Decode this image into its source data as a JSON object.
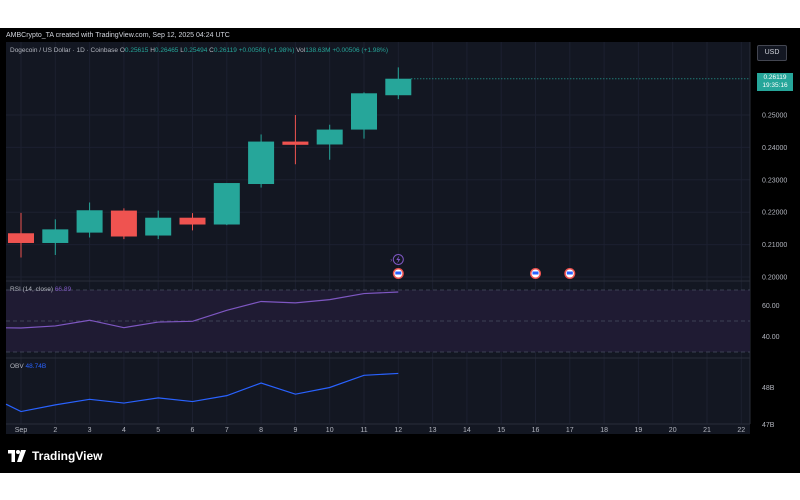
{
  "header": {
    "title": "AMBCrypto_TA created with TradingView.com, Sep 12, 2025 04:24 UTC"
  },
  "symbol": {
    "name": "Dogecoin / US Dollar · 1D · Coinbase",
    "open_label": "O",
    "open": "0.25615",
    "high_label": "H",
    "high": "0.26465",
    "low_label": "L",
    "low": "0.25494",
    "close_label": "C",
    "close": "0.26119",
    "change": "+0.00506 (+1.98%)",
    "vol_label": "Vol",
    "vol": "138.63M",
    "vol_change": "+0.00506 (+1.98%)"
  },
  "currency_button": "USD",
  "last_price": {
    "price": "0.26119",
    "countdown": "19:35:16"
  },
  "rsi_label": {
    "name": "RSI (14, close)",
    "value": "66.89"
  },
  "obv_label": {
    "name": "OBV",
    "value": "48.74B"
  },
  "brand": "TradingView",
  "colors": {
    "up": "#26a69a",
    "down": "#ef5350",
    "rsi_line": "#7e57c2",
    "obv_line": "#2962ff",
    "pane_bg": "#131722",
    "rsi_band": "#1f1b33"
  },
  "chart_data": {
    "type": "candlestick",
    "x_ticks": [
      "Sep",
      "2",
      "3",
      "4",
      "5",
      "6",
      "7",
      "8",
      "9",
      "10",
      "11",
      "12",
      "13",
      "14",
      "15",
      "16",
      "17",
      "18",
      "19",
      "20",
      "21",
      "22"
    ],
    "ohlc": [
      {
        "day": 1,
        "open": 0.2135,
        "high": 0.2198,
        "low": 0.206,
        "close": 0.2105
      },
      {
        "day": 2,
        "open": 0.2105,
        "high": 0.2178,
        "low": 0.2068,
        "close": 0.2147
      },
      {
        "day": 3,
        "open": 0.2137,
        "high": 0.223,
        "low": 0.2122,
        "close": 0.2206
      },
      {
        "day": 4,
        "open": 0.2205,
        "high": 0.2212,
        "low": 0.2117,
        "close": 0.2125
      },
      {
        "day": 5,
        "open": 0.2128,
        "high": 0.2205,
        "low": 0.2117,
        "close": 0.2183
      },
      {
        "day": 6,
        "open": 0.2183,
        "high": 0.2197,
        "low": 0.2144,
        "close": 0.2162
      },
      {
        "day": 7,
        "open": 0.2162,
        "high": 0.2289,
        "low": 0.216,
        "close": 0.229
      },
      {
        "day": 8,
        "open": 0.2287,
        "high": 0.244,
        "low": 0.2276,
        "close": 0.2418
      },
      {
        "day": 9,
        "open": 0.2418,
        "high": 0.25,
        "low": 0.2348,
        "close": 0.2408
      },
      {
        "day": 10,
        "open": 0.2409,
        "high": 0.247,
        "low": 0.2362,
        "close": 0.2455
      },
      {
        "day": 11,
        "open": 0.2455,
        "high": 0.257,
        "low": 0.2427,
        "close": 0.2567
      },
      {
        "day": 12,
        "open": 0.2561,
        "high": 0.2647,
        "low": 0.2549,
        "close": 0.2612
      }
    ],
    "price_axis": {
      "ticks": [
        "0.20000",
        "0.21000",
        "0.22000",
        "0.23000",
        "0.24000",
        "0.25000"
      ],
      "ylim": [
        0.2,
        0.26
      ]
    },
    "rsi": {
      "values": [
        45.5,
        46.8,
        50.5,
        45.7,
        49.3,
        49.8,
        56.9,
        62.6,
        61.7,
        63.8,
        67.7,
        68.7
      ],
      "ticks": [
        "40.00",
        "60.00"
      ],
      "band": [
        30,
        70
      ]
    },
    "obv": {
      "values": [
        47.55,
        47.35,
        47.53,
        47.68,
        47.58,
        47.72,
        47.62,
        47.78,
        48.12,
        47.82,
        48.0,
        48.33,
        48.38
      ],
      "x": [
        0.5,
        1,
        2,
        3,
        4,
        5,
        6,
        7,
        8,
        9,
        10,
        11,
        12
      ],
      "ticks": [
        "47B",
        "48B"
      ]
    },
    "event_markers": [
      {
        "day": 12,
        "type": "flag"
      },
      {
        "day": 16,
        "type": "flag"
      },
      {
        "day": 17,
        "type": "flag"
      }
    ],
    "lightning_marker_day": 12
  }
}
